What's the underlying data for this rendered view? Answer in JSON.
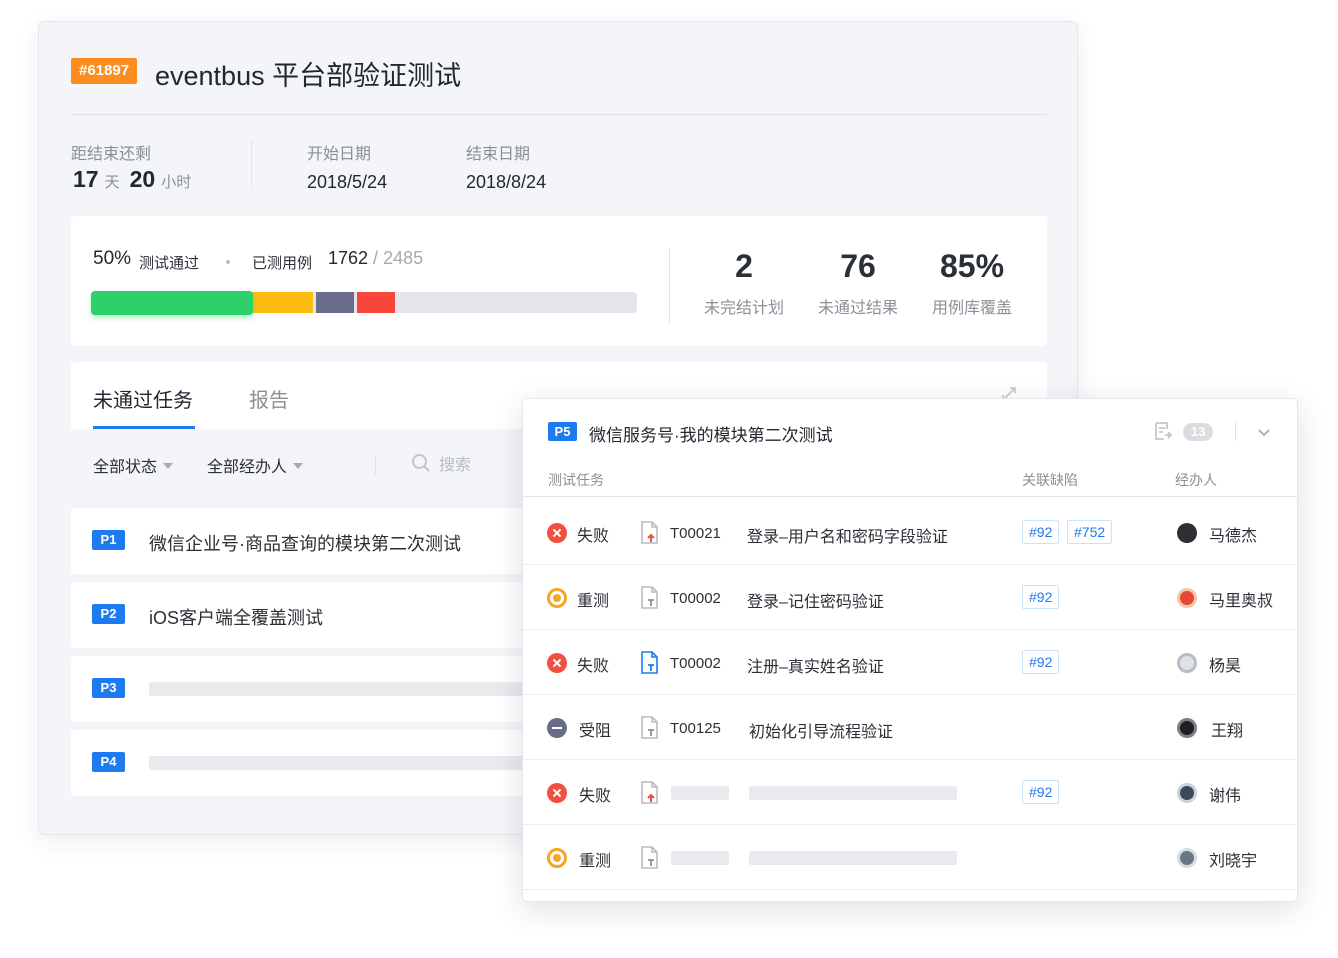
{
  "project": {
    "id": "#61897",
    "title": "eventbus 平台部验证测试",
    "remaining_label": "距结束还剩",
    "remaining_days": "17",
    "days_unit": "天",
    "remaining_hours": "20",
    "hours_unit": "小时",
    "start_label": "开始日期",
    "start_date": "2018/5/24",
    "end_label": "结束日期",
    "end_date": "2018/8/24"
  },
  "progress": {
    "pass_percent": "50%",
    "pass_label": "测试通过",
    "tested_label": "已测用例",
    "tested_count": "1762",
    "tested_sep": " / ",
    "total_count": "2485",
    "segments": {
      "passed": 0.5,
      "retest": 0.2,
      "blocked": 0.12,
      "failed": 0.12
    }
  },
  "stats": [
    {
      "value": "2",
      "label": "未完结计划"
    },
    {
      "value": "76",
      "label": "未通过结果"
    },
    {
      "value": "85%",
      "label": "用例库覆盖"
    }
  ],
  "tabs": {
    "active": "未通过任务",
    "inactive": "报告"
  },
  "filters": {
    "status": "全部状态",
    "assignee": "全部经办人",
    "search_placeholder": "搜索"
  },
  "tasks": [
    {
      "priority": "P1",
      "name": "微信企业号·商品查询的模块第二次测试"
    },
    {
      "priority": "P2",
      "name": "iOS客户端全覆盖测试"
    },
    {
      "priority": "P3",
      "name": ""
    },
    {
      "priority": "P4",
      "name": ""
    }
  ],
  "detail": {
    "priority": "P5",
    "title": "微信服务号·我的模块第二次测试",
    "count": "13",
    "columns": {
      "task": "测试任务",
      "defects": "关联缺陷",
      "assignee": "经办人"
    },
    "rows": [
      {
        "status": "失败",
        "code": "T00021",
        "desc": "登录–用户名和密码字段验证",
        "tags": [
          "#92",
          "#752"
        ],
        "assignee": "马德杰"
      },
      {
        "status": "重测",
        "code": "T00002",
        "desc": "登录–记住密码验证",
        "tags": [
          "#92"
        ],
        "assignee": "马里奥叔"
      },
      {
        "status": "失败",
        "code": "T00002",
        "desc": "注册–真实姓名验证",
        "tags": [
          "#92"
        ],
        "assignee": "杨昊"
      },
      {
        "status": "受阻",
        "code": "T00125",
        "desc": "初始化引导流程验证",
        "tags": [],
        "assignee": "王翔"
      },
      {
        "status": "失败",
        "code": "",
        "desc": "",
        "tags": [
          "#92"
        ],
        "assignee": "谢伟"
      },
      {
        "status": "重测",
        "code": "",
        "desc": "",
        "tags": [],
        "assignee": "刘晓宇"
      }
    ]
  },
  "colors": {
    "accent": "#1e7bef",
    "orange": "#fe8c1e",
    "pass": "#2cd16a",
    "retest": "#fdbd10",
    "blocked": "#6a6d8a",
    "fail": "#f8473a"
  }
}
